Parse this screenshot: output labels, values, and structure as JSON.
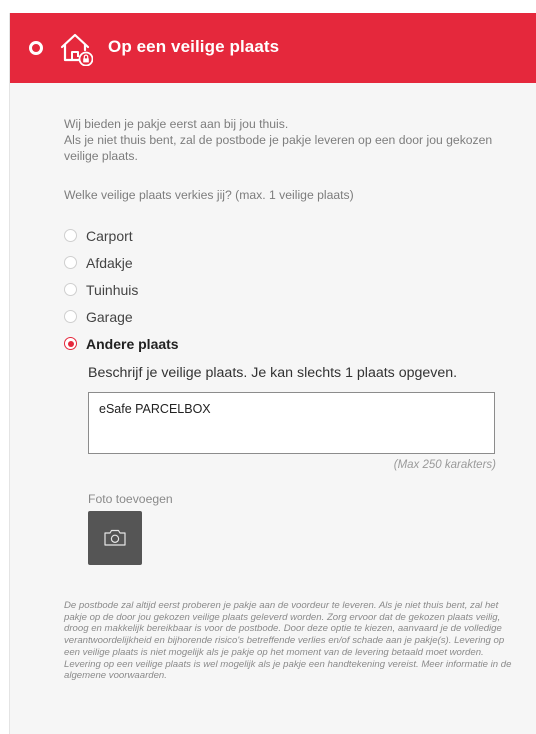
{
  "header": {
    "title": "Op een veilige plaats",
    "icon": "house-lock-icon",
    "bg_color": "#e5283c"
  },
  "intro": {
    "line1": "Wij bieden je pakje eerst aan bij jou thuis.",
    "line2": "Als je niet thuis bent, zal de postbode je pakje leveren op een door jou gekozen veilige plaats."
  },
  "question": "Welke veilige plaats verkies jij? (max. 1 veilige plaats)",
  "options": [
    {
      "label": "Carport",
      "selected": false
    },
    {
      "label": "Afdakje",
      "selected": false
    },
    {
      "label": "Tuinhuis",
      "selected": false
    },
    {
      "label": "Garage",
      "selected": false
    },
    {
      "label": "Andere plaats",
      "selected": true
    }
  ],
  "describe": {
    "label": "Beschrijf je veilige plaats. Je kan slechts 1 plaats opgeven.",
    "value": "eSafe PARCELBOX",
    "max_note": "(Max 250 karakters)"
  },
  "photo": {
    "label": "Foto toevoegen",
    "icon": "camera-icon"
  },
  "disclaimer": "De postbode zal altijd eerst proberen je pakje aan de voordeur te leveren. Als je niet thuis bent, zal het pakje op de door jou gekozen veilige plaats geleverd worden. Zorg ervoor dat de gekozen plaats veilig, droog en makkelijk bereikbaar is voor de postbode. Door deze optie te kiezen, aanvaard je de volledige verantwoordelijkheid en bijhorende risico's betreffende verlies en/of schade aan je pakje(s). Levering op een veilige plaats is niet mogelijk als je pakje op het moment van de levering betaald moet worden. Levering op een veilige plaats is wel mogelijk als je pakje een handtekening vereist. Meer informatie in de algemene voorwaarden."
}
